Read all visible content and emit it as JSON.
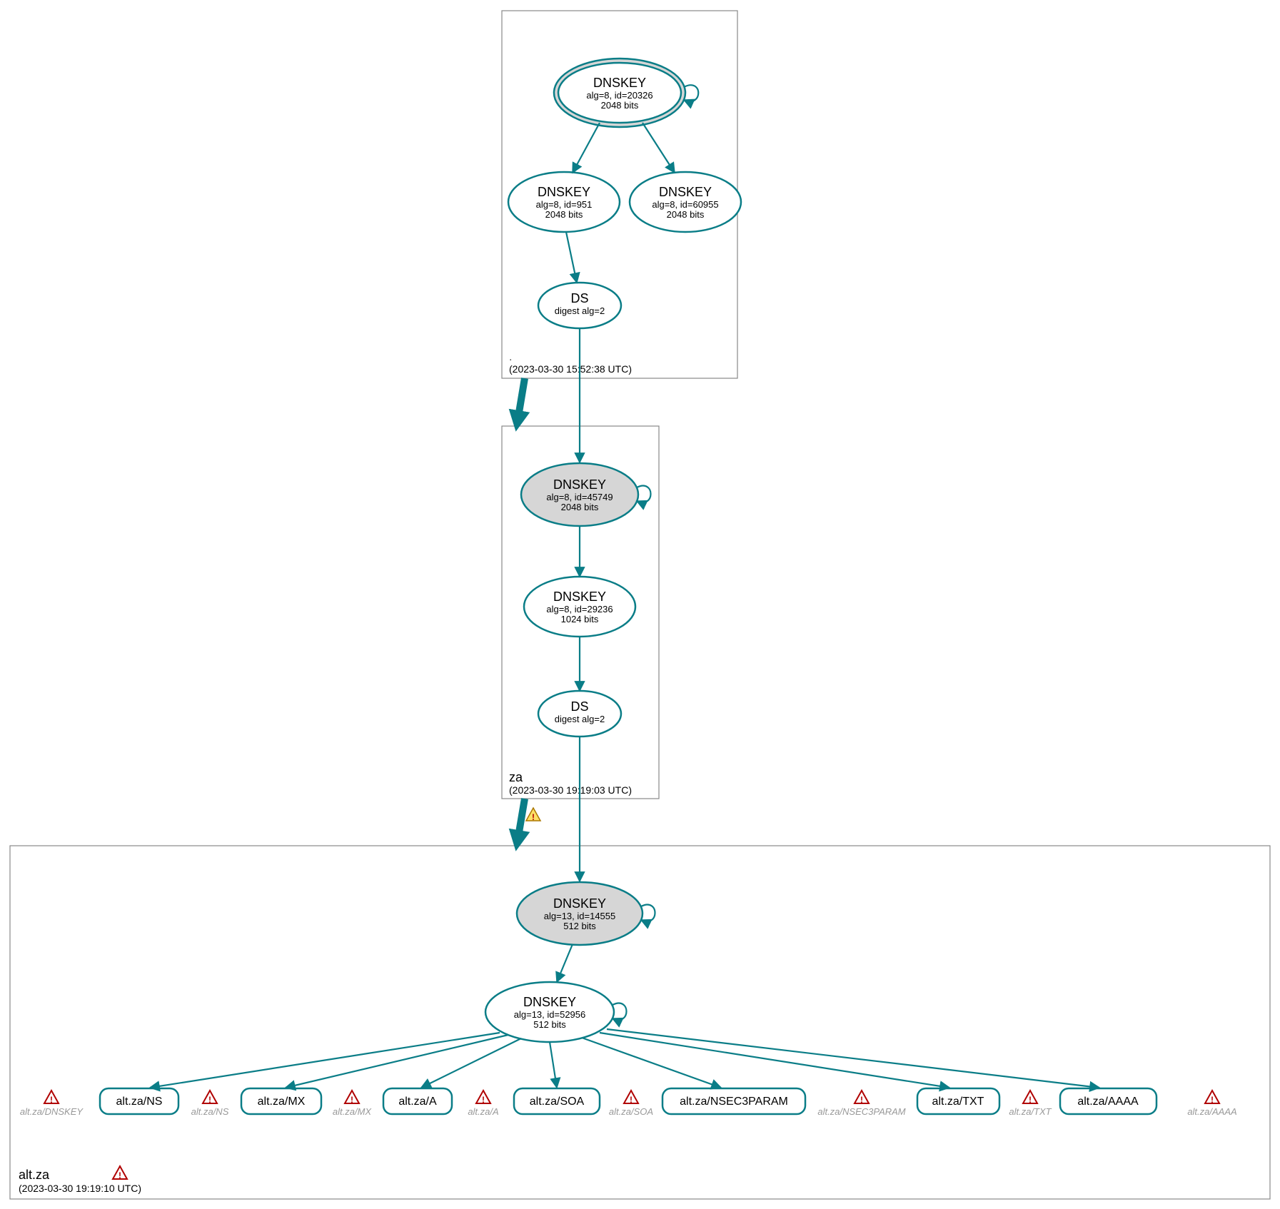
{
  "colors": {
    "accent": "#0a7d87",
    "warn": "#b00000",
    "warnFill": "#ffe066",
    "sep": "#d6d6d6"
  },
  "zones": {
    "root": {
      "label": ".",
      "timestamp": "(2023-03-30 15:52:38 UTC)"
    },
    "za": {
      "label": "za",
      "timestamp": "(2023-03-30 19:19:03 UTC)"
    },
    "altza": {
      "label": "alt.za",
      "timestamp": "(2023-03-30 19:19:10 UTC)"
    }
  },
  "nodes": {
    "root_ksk": {
      "title": "DNSKEY",
      "line1": "alg=8, id=20326",
      "line2": "2048 bits"
    },
    "root_zsk1": {
      "title": "DNSKEY",
      "line1": "alg=8, id=951",
      "line2": "2048 bits"
    },
    "root_zsk2": {
      "title": "DNSKEY",
      "line1": "alg=8, id=60955",
      "line2": "2048 bits"
    },
    "root_ds": {
      "title": "DS",
      "line1": "digest alg=2",
      "line2": ""
    },
    "za_ksk": {
      "title": "DNSKEY",
      "line1": "alg=8, id=45749",
      "line2": "2048 bits"
    },
    "za_zsk": {
      "title": "DNSKEY",
      "line1": "alg=8, id=29236",
      "line2": "1024 bits"
    },
    "za_ds": {
      "title": "DS",
      "line1": "digest alg=2",
      "line2": ""
    },
    "altza_ksk": {
      "title": "DNSKEY",
      "line1": "alg=13, id=14555",
      "line2": "512 bits"
    },
    "altza_zsk": {
      "title": "DNSKEY",
      "line1": "alg=13, id=52956",
      "line2": "512 bits"
    }
  },
  "records": {
    "ns": {
      "label": "alt.za/NS"
    },
    "mx": {
      "label": "alt.za/MX"
    },
    "a": {
      "label": "alt.za/A"
    },
    "soa": {
      "label": "alt.za/SOA"
    },
    "nsec": {
      "label": "alt.za/NSEC3PARAM"
    },
    "txt": {
      "label": "alt.za/TXT"
    },
    "aaaa": {
      "label": "alt.za/AAAA"
    }
  },
  "warnings": {
    "dnskey": "alt.za/DNSKEY",
    "ns": "alt.za/NS",
    "mx": "alt.za/MX",
    "a": "alt.za/A",
    "soa": "alt.za/SOA",
    "nsec": "alt.za/NSEC3PARAM",
    "txt": "alt.za/TXT",
    "aaaa": "alt.za/AAAA"
  }
}
